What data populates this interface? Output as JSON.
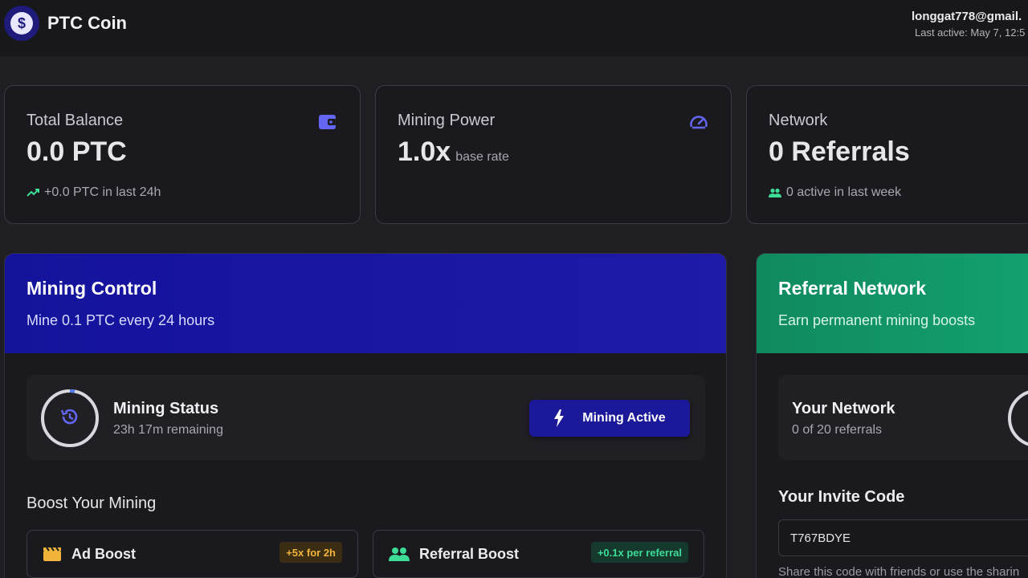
{
  "header": {
    "brand_icon": "dollar-coin-icon",
    "brand_name": "PTC Coin",
    "user_email": "longgat778@gmail.",
    "last_active": "Last active: May 7, 12:5"
  },
  "stats": {
    "balance": {
      "title": "Total Balance",
      "value": "0.0 PTC",
      "sub": "+0.0 PTC in last 24h",
      "icon": "wallet-icon",
      "sub_icon": "trending-up-icon"
    },
    "power": {
      "title": "Mining Power",
      "value": "1.0x",
      "unit": "base rate",
      "icon": "speedometer-icon"
    },
    "network": {
      "title": "Network",
      "value": "0 Referrals",
      "sub": "0 active in last week",
      "sub_icon": "users-icon"
    }
  },
  "mining": {
    "title": "Mining Control",
    "subtitle": "Mine 0.1 PTC every 24 hours",
    "status_title": "Mining Status",
    "status_remaining": "23h 17m remaining",
    "button_label": "Mining Active",
    "boost_section": "Boost Your Mining",
    "boosts": [
      {
        "name": "Ad Boost",
        "badge": "+5x for 2h",
        "icon": "clapperboard-icon"
      },
      {
        "name": "Referral Boost",
        "badge": "+0.1x per referral",
        "icon": "users-icon"
      }
    ]
  },
  "referral": {
    "title": "Referral Network",
    "subtitle": "Earn permanent mining boosts",
    "network_title": "Your Network",
    "network_sub": "0 of 20 referrals",
    "invite_title": "Your Invite Code",
    "invite_code": "T767BDYE",
    "invite_note": "Share this code with friends or use the sharin"
  },
  "colors": {
    "accent_indigo": "#6366f1",
    "mining_blue": "#1b189a",
    "referral_green": "#0f8a5e",
    "positive_green": "#3ddc97",
    "amber": "#f2b43a"
  }
}
